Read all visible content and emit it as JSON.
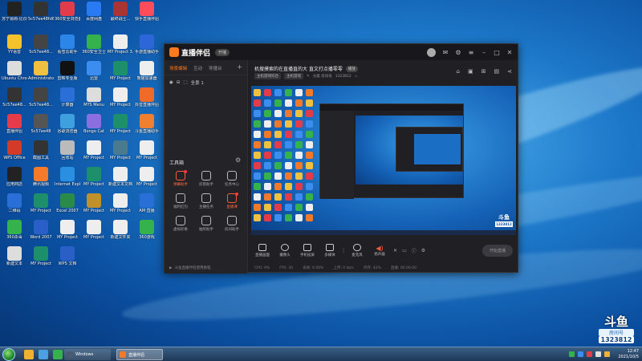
{
  "desktop": {
    "icons": [
      {
        "label": "苏宁易购-比价",
        "color": "#222"
      },
      {
        "label": "5c57ee48fd6",
        "color": "#333"
      },
      {
        "label": "360安全浏览器",
        "color": "#e23b4a"
      },
      {
        "label": "百度网盘",
        "color": "#2a7bf3"
      },
      {
        "label": "最终战士...",
        "color": "#a33"
      },
      {
        "label": "快手直播伴侣",
        "color": "#ff4c5a"
      },
      {
        "label": "YY语音",
        "color": "#f4c22b"
      },
      {
        "label": "5c57ee48...",
        "color": "#444"
      },
      {
        "label": "看雪云助手",
        "color": "#2c86e8"
      },
      {
        "label": "360安全卫士",
        "color": "#35b24b"
      },
      {
        "label": "MY Project 3.Unlock",
        "color": "#eee"
      },
      {
        "label": "手游直播助手",
        "color": "#2c66d8"
      },
      {
        "label": "Ubuntu Chrome",
        "color": "#ddd"
      },
      {
        "label": "Administrator",
        "color": "#f0c040"
      },
      {
        "label": "剪映专业版",
        "color": "#111"
      },
      {
        "label": "迅雷",
        "color": "#3c8df0"
      },
      {
        "label": "MY Project",
        "color": "#1d8f6a"
      },
      {
        "label": "熊猫加速器",
        "color": "#eee"
      },
      {
        "label": "5c57ee48...",
        "color": "#333"
      },
      {
        "label": "5c57ee48...",
        "color": "#444"
      },
      {
        "label": "计算器",
        "color": "#2a6fd8"
      },
      {
        "label": "MYS Menu",
        "color": "#ddd"
      },
      {
        "label": "MY Project",
        "color": "#eee"
      },
      {
        "label": "抖音直播伴侣",
        "color": "#f06a2a"
      },
      {
        "label": "直播伴侣",
        "color": "#e63b4a"
      },
      {
        "label": "5c57ee48",
        "color": "#555"
      },
      {
        "label": "谷歌浏览器",
        "color": "#3fa0e0"
      },
      {
        "label": "Bongo Cat",
        "color": "#8b6fe0"
      },
      {
        "label": "MY Project",
        "color": "#1d8f6a"
      },
      {
        "label": "斗鱼直播助手",
        "color": "#f08030"
      },
      {
        "label": "WPS Office",
        "color": "#d23b2a"
      },
      {
        "label": "截图工具",
        "color": "#333"
      },
      {
        "label": "回收站",
        "color": "#bbb"
      },
      {
        "label": "MY Project",
        "color": "#eee"
      },
      {
        "label": "MY Project",
        "color": "#4a7a90"
      },
      {
        "label": "MY Project",
        "color": "#eee"
      },
      {
        "label": "应用商店",
        "color": "#222"
      },
      {
        "label": "腾讯视频",
        "color": "#f57a2a"
      },
      {
        "label": "Internet Explorer",
        "color": "#2a8fe0"
      },
      {
        "label": "MY Project",
        "color": "#1d8f6a"
      },
      {
        "label": "新建文本文档",
        "color": "#eee"
      },
      {
        "label": "MY Project",
        "color": "#eee"
      },
      {
        "label": "二维码",
        "color": "#2a6fd8"
      },
      {
        "label": "MY Project",
        "color": "#1d8f6a"
      },
      {
        "label": "Excel 2007",
        "color": "#2a8a4a"
      },
      {
        "label": "MY Project",
        "color": "#c0902a"
      },
      {
        "label": "MY Project",
        "color": "#eee"
      },
      {
        "label": "AM 直播",
        "color": "#2a6fd8"
      },
      {
        "label": "360杀毒",
        "color": "#35b24b"
      },
      {
        "label": "Word 2007",
        "color": "#2a5fc8"
      },
      {
        "label": "MY Project",
        "color": "#eee"
      },
      {
        "label": "MY Project",
        "color": "#eee"
      },
      {
        "label": "新建文件夹",
        "color": "#eee"
      },
      {
        "label": "360游戏",
        "color": "#35b24b"
      },
      {
        "label": "新建文本",
        "color": "#ddd"
      },
      {
        "label": "MY Project",
        "color": "#1d8f6a"
      },
      {
        "label": "WPS 文档",
        "color": "#2a5fc8"
      }
    ]
  },
  "app": {
    "logo_text": "直播伴侣",
    "pill": "开播",
    "tabs": [
      "场景编辑",
      "互动",
      "导播台"
    ],
    "scene_label": "全景 1",
    "tools_title": "工具箱",
    "tools": [
      {
        "label": "弹幕助手",
        "hot": true,
        "dot": true
      },
      {
        "label": "房管助手",
        "hot": false,
        "dot": false
      },
      {
        "label": "任务中心",
        "hot": false,
        "dot": false
      },
      {
        "label": "福利红包",
        "hot": false,
        "dot": false
      },
      {
        "label": "主播任务",
        "hot": false,
        "dot": false
      },
      {
        "label": "直播课",
        "hot": true,
        "dot": true
      },
      {
        "label": "虚拟形象",
        "hot": false,
        "dot": false
      },
      {
        "label": "抽奖助手",
        "hot": false,
        "dot": false
      },
      {
        "label": "房间助手",
        "hot": false,
        "dot": false
      }
    ],
    "footer_text": "斗鱼直播伴侣使用教程",
    "room_title": "机搜摸索的在直播直的大 直文打点播零零",
    "room_badge": "播放",
    "cat_tags": [
      "主机游戏综合",
      "主机游戏"
    ],
    "room_id_label": "分类 房间号",
    "room_id": "1323812",
    "controls": [
      {
        "label": "直播画面"
      },
      {
        "label": "摄像头"
      },
      {
        "label": "手机投屏"
      },
      {
        "label": "多媒体"
      },
      {
        "label": "麦克风"
      },
      {
        "label": "扬声器"
      }
    ],
    "live_button": "开始直播",
    "status": [
      "CPU: 9%",
      "FPS: 30",
      "丢帧: 0.00%",
      "上传: 0 kb/s",
      "内存: 42%",
      "直播: 00:00:00"
    ]
  },
  "watermark": {
    "logo": "斗鱼",
    "room_label": "房间号",
    "room_number": "1323812"
  },
  "taskbar": {
    "tasks": [
      {
        "label": "Windows",
        "color": "#4a5a70"
      },
      {
        "label": "直播伴侣",
        "color": "#f07a2a"
      }
    ],
    "time": "12:47",
    "date": "2021/10/5"
  }
}
